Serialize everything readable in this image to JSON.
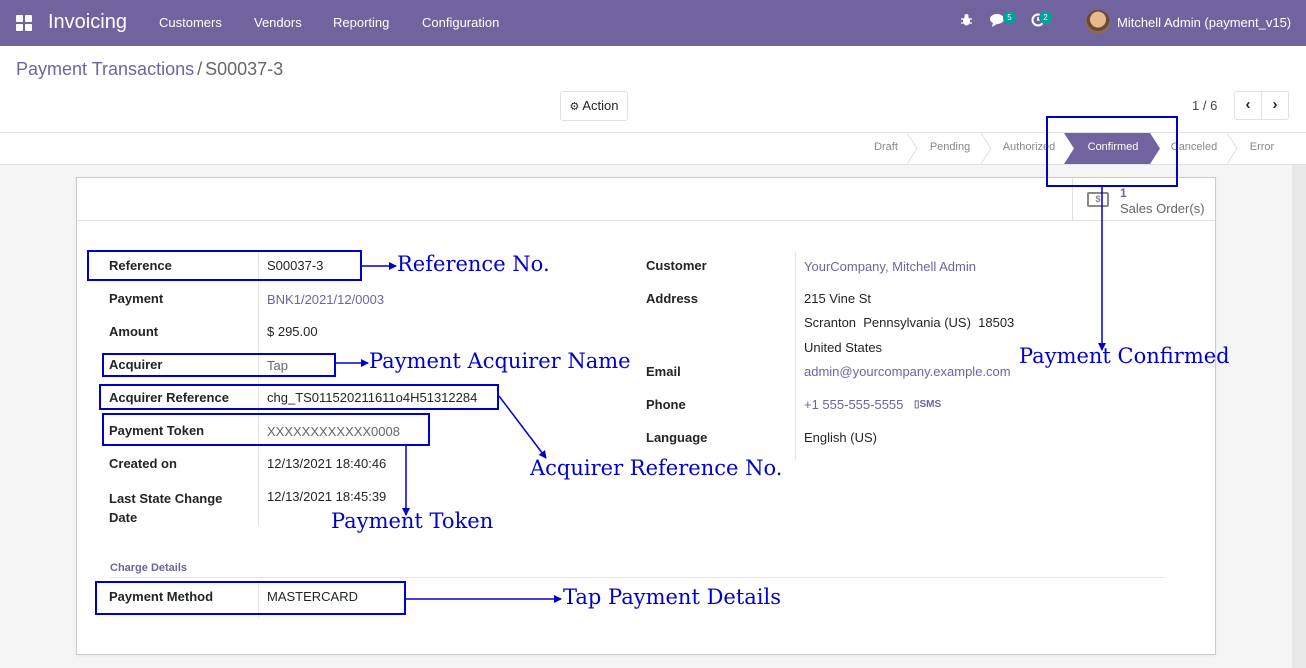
{
  "navbar": {
    "app_name": "Invoicing",
    "menu": [
      "Customers",
      "Vendors",
      "Reporting",
      "Configuration"
    ],
    "messages_count": "5",
    "activities_count": "2",
    "user_name": "Mitchell Admin (payment_v15)"
  },
  "breadcrumb": {
    "parent": "Payment Transactions",
    "separator": "/",
    "current": "S00037-3"
  },
  "control": {
    "action_label": "Action",
    "pager": "1 / 6"
  },
  "status_stages": [
    {
      "label": "Draft",
      "active": false
    },
    {
      "label": "Pending",
      "active": false
    },
    {
      "label": "Authorized",
      "active": false
    },
    {
      "label": "Confirmed",
      "active": true
    },
    {
      "label": "Canceled",
      "active": false
    },
    {
      "label": "Error",
      "active": false
    }
  ],
  "smart_button": {
    "count": "1",
    "label": "Sales Order(s)"
  },
  "left_fields": [
    {
      "label": "Reference",
      "value": "S00037-3"
    },
    {
      "label": "Payment",
      "value": "BNK1/2021/12/0003"
    },
    {
      "label": "Amount",
      "value": "$ 295.00"
    },
    {
      "label": "Acquirer",
      "value": "Tap"
    },
    {
      "label": "Acquirer Reference",
      "value": "chg_TS011520211611o4H51312284"
    },
    {
      "label": "Payment Token",
      "value": "XXXXXXXXXXXX0008"
    },
    {
      "label": "Created on",
      "value": "12/13/2021 18:40:46"
    },
    {
      "label": "Last State Change Date",
      "value": "12/13/2021 18:45:39"
    }
  ],
  "right_fields": {
    "customer_label": "Customer",
    "customer_value": "YourCompany, Mitchell Admin",
    "address_label": "Address",
    "address_lines": [
      "215 Vine St",
      "Scranton  Pennsylvania (US)  18503",
      "United States"
    ],
    "email_label": "Email",
    "email_value": "admin@yourcompany.example.com",
    "phone_label": "Phone",
    "phone_value": "+1 555-555-5555",
    "sms_label": "SMS",
    "language_label": "Language",
    "language_value": "English (US)"
  },
  "charge_details": {
    "title": "Charge Details",
    "label": "Payment Method",
    "value": "MASTERCARD"
  },
  "annotations": {
    "reference": "Reference No.",
    "acquirer": "Payment Acquirer Name",
    "acquirer_ref": "Acquirer Reference No.",
    "token": "Payment Token",
    "confirmed": "Payment Confirmed",
    "tap_details": "Tap Payment Details"
  },
  "colors": {
    "brand": "#71639e",
    "annotation": "#0000cc",
    "badge": "#00a09d"
  }
}
